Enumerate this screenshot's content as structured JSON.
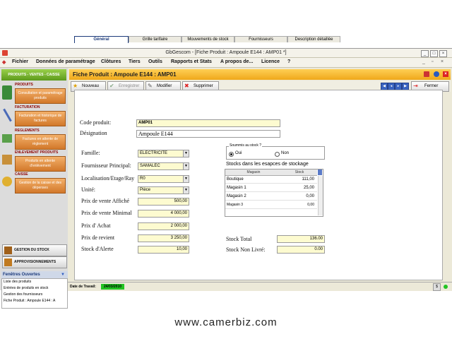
{
  "window": {
    "title": "GbGescom - [Fiche Produit : Ampoule  E144 : AMP01 *]"
  },
  "menu": [
    "Fichier",
    "Données de paramétrage",
    "Clôtures",
    "Tiers",
    "Outils",
    "Rapports et Stats",
    "A propos de...",
    "Licence",
    "?"
  ],
  "sidebar": {
    "header": "PRODUITS - VENTES - CAISSE",
    "sections": [
      {
        "title": "PRODUITS",
        "button": "Consultation et paramétrage produits"
      },
      {
        "title": "FACTURATION",
        "button": "Facturation et historique de factures"
      },
      {
        "title": "REGLEMENTS",
        "button": "Factures en attente de règlement"
      },
      {
        "title": "ENLEVEMENT PRODUITS",
        "button": "Produits en attente d'enlèvement"
      },
      {
        "title": "CAISSE",
        "button": "Gestion de la caisse et des dépenses"
      }
    ],
    "big_buttons": [
      "GESTION DU STOCK",
      "APPROVISIONNEMENTS"
    ],
    "open_windows_title": "Fenêtres Ouvertes",
    "open_windows": [
      "Liste des produits",
      "Entrées de produits en stock",
      "Gestion des fournisseurs",
      "Fiche Produit : Ampoule  E144 : A"
    ]
  },
  "form": {
    "title": "Fiche Produit : Ampoule  E144 : AMP01",
    "toolbar": {
      "nouveau": "Nouveau",
      "enregistrer": "Enregistrer",
      "modifier": "Modifier",
      "supprimer": "Supprimer",
      "fermer": "Fermer"
    },
    "tabs": [
      "Général",
      "Grille tarifaire",
      "Mouvements de stock",
      "Fournisseurs",
      "Description détaillée"
    ],
    "code_label": "Code produit:",
    "code_value": "AMP01",
    "designation_label": "Désignation",
    "designation_value": "Ampoule  E144",
    "famille_label": "Famille:",
    "famille_value": "ELECTRICITE",
    "fournisseur_label": "Fournisseur Principal:",
    "fournisseur_value": "SAMALEC",
    "localisation_label": "Localisation/Etage/Ray",
    "localisation_value": "R0",
    "unite_label": "Unité:",
    "unite_value": "Pièce",
    "pv_affiche_label": "Prix de vente Affiché",
    "pv_affiche_value": "500,00",
    "pv_minimal_label": "Prix de vente Minimal",
    "pv_minimal_value": "4 000,00",
    "prix_achat_label": "Prix d' Achat",
    "prix_achat_value": "2 000,00",
    "prix_revient_label": "Prix de revient",
    "prix_revient_value": "3 250,00",
    "stock_alerte_label": "Stock d'Alerte",
    "stock_alerte_value": "10,00",
    "soumis_label": "Soummis au stock ?",
    "oui": "Oui",
    "non": "Non",
    "stocks_title": "Stocks dans les esapces de stockage",
    "grid_headers": [
      "Magasin",
      "Stock"
    ],
    "stock_rows": [
      {
        "name": "Boutique",
        "value": "111,00"
      },
      {
        "name": "Magasin 1",
        "value": "25,00"
      },
      {
        "name": "Magasin 2",
        "value": "0,00"
      },
      {
        "name": "Magasin 3",
        "value": "0,00"
      }
    ],
    "stock_total_label": "Stock Total",
    "stock_total_value": "136.00",
    "stock_non_livre_label": "Stock Non Livré:",
    "stock_non_livre_value": "0.00"
  },
  "status": {
    "label": "Date de Travail:",
    "date": "24/03/2010"
  },
  "watermark": "www.camerbiz.com",
  "colors": {
    "header": "#f0a81a",
    "field": "#fdfbd0",
    "sidebar_button": "#d2782a",
    "date_bg": "#22c422"
  }
}
